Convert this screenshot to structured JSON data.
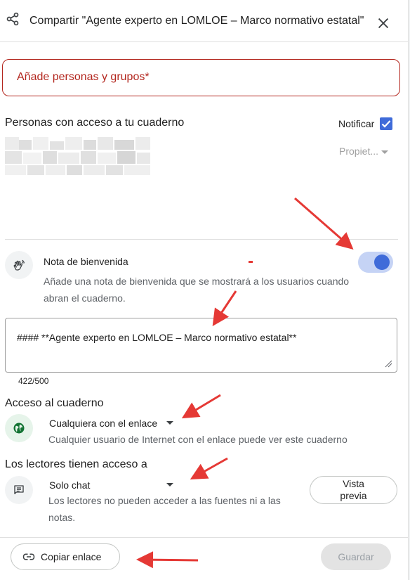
{
  "dialog": {
    "title": "Compartir \"Agente experto en LOMLOE – Marco normativo estatal\"",
    "icons": {
      "share": "share-icon",
      "close": "close-icon"
    }
  },
  "add_people": {
    "placeholder": "Añade personas y grupos*"
  },
  "people_section": {
    "title": "Personas con acceso a tu cuaderno",
    "notify_label": "Notificar",
    "notify_checked": true,
    "role_label": "Propiet..."
  },
  "welcome_note": {
    "icon": "waving-hand-icon",
    "title": "Nota de bienvenida",
    "enabled": true,
    "description": "Añade una nota de bienvenida que se mostrará a los usuarios cuando abran el cuaderno.",
    "text": "#### **Agente experto en LOMLOE – Marco normativo estatal**",
    "char_count": "422/500"
  },
  "access": {
    "title": "Acceso al cuaderno",
    "icon": "globe-icon",
    "option": "Cualquiera con el enlace",
    "description": "Cualquier usuario de Internet con el enlace puede ver este cuaderno"
  },
  "readers": {
    "title": "Los lectores tienen acceso a",
    "icon": "chat-icon",
    "option": "Solo chat",
    "description": "Los lectores no pueden acceder a las fuentes ni a las notas.",
    "preview_label": "Vista previa"
  },
  "footer": {
    "copy_link_label": "Copiar enlace",
    "copy_icon": "link-icon",
    "save_label": "Guardar"
  },
  "colors": {
    "accent": "#3f6bd9",
    "error": "#b3261e",
    "annotation_arrow": "#e53935",
    "access_icon_bg": "#e6f4ea",
    "globe": "#137333"
  }
}
